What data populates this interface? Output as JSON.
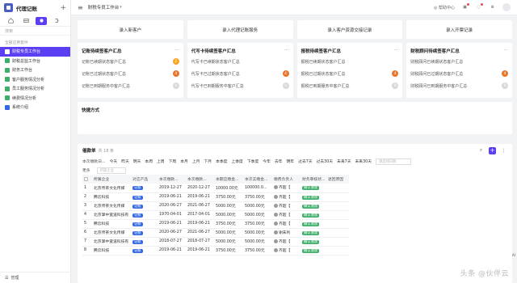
{
  "sidebar": {
    "title": "代理记账",
    "search_placeholder": "搜索",
    "group_label": "全部应用套件",
    "items": [
      {
        "label": "财税专员工作台",
        "color": "#ffffff",
        "active": true
      },
      {
        "label": "财税总监工作台",
        "color": "#3fae6a",
        "active": false
      },
      {
        "label": "财务工作台",
        "color": "#3fae6a",
        "active": false
      },
      {
        "label": "客户服务情况分析",
        "color": "#3fae6a",
        "active": false
      },
      {
        "label": "员工服务情况分析",
        "color": "#3fae6a",
        "active": false
      },
      {
        "label": "续费情况分析",
        "color": "#3fae6a",
        "active": false
      },
      {
        "label": "系统介绍",
        "color": "#3468e3",
        "active": false
      }
    ],
    "footer_label": "管理"
  },
  "topbar": {
    "title": "财税专员工作台",
    "help_label": "帮助中心"
  },
  "actions": [
    "录入新客户",
    "录入代理记账服务",
    "录入客户资源交接记录",
    "录入开票记录"
  ],
  "cards": [
    {
      "title": "记账待续签客户汇总",
      "rows": [
        {
          "label": "记账已续期状态客户汇总",
          "count": "2",
          "color": "#f5a623"
        },
        {
          "label": "记账已过期状态客户汇总",
          "count": "4",
          "color": "#e8762d"
        },
        {
          "label": "记账已到期服务中客户汇总",
          "count": "0",
          "color": "#d9d9d9"
        }
      ]
    },
    {
      "title": "代写卡待续签客户汇总",
      "rows": [
        {
          "label": "代写卡已续期状态客户汇总",
          "count": "",
          "color": ""
        },
        {
          "label": "代写卡已过期状态客户汇总",
          "count": "4",
          "color": "#e8762d"
        },
        {
          "label": "代写卡已到期服务中客户汇总",
          "count": "0",
          "color": "#d9d9d9"
        }
      ]
    },
    {
      "title": "报税待续签客户汇总",
      "rows": [
        {
          "label": "报税已续期状态客户汇总",
          "count": "",
          "color": ""
        },
        {
          "label": "报税已过期状态客户汇总",
          "count": "4",
          "color": "#e8762d"
        },
        {
          "label": "报税已到期服务中客户汇总",
          "count": "0",
          "color": "#d9d9d9"
        }
      ]
    },
    {
      "title": "财税顾问待续签客户汇总",
      "rows": [
        {
          "label": "财税顾问已续期状态客户汇总",
          "count": "",
          "color": ""
        },
        {
          "label": "财税顾问已过期状态客户汇总",
          "count": "4",
          "color": "#e8762d"
        },
        {
          "label": "财税顾问已到期服务中客户汇总",
          "count": "0",
          "color": "#d9d9d9"
        }
      ]
    }
  ],
  "quick": {
    "title": "快捷方式"
  },
  "panel": {
    "title": "催款单",
    "count": "共 18 条",
    "filter_label": "本次缴款日...",
    "chips": [
      "今天",
      "昨天",
      "明天",
      "本周",
      "上周",
      "下周",
      "本月",
      "上月",
      "下月",
      "本季度",
      "上季度",
      "下季度",
      "今年",
      "去年",
      "明年",
      "过去7天",
      "过去30天",
      "未来7天",
      "未来30天"
    ],
    "date_placeholder": "请选择日期",
    "more_label": "更多",
    "select_placeholder": "所属企业",
    "columns": [
      "",
      "所属企业",
      "对应产品",
      "本次缴款...",
      "本次缴款...",
      "本期应缴金...",
      "本次实缴金...",
      "缴费负责人",
      "财务审核状...",
      "退回原因"
    ],
    "rows": [
      {
        "n": "1",
        "company": "北京传茶文化传媒",
        "product": "记账",
        "d1": "2019-12-27",
        "d2": "2020-12-27",
        "due": "10000.00元",
        "paid": "100000.0...",
        "owner": "齐超【",
        "status": "确认收款"
      },
      {
        "n": "2",
        "company": "腾云科技",
        "product": "记账",
        "d1": "2019-06-21",
        "d2": "2019-06-21",
        "due": "3750.00元",
        "paid": "3750.00元",
        "owner": "齐超【",
        "status": "确认收款"
      },
      {
        "n": "3",
        "company": "北京传茶文化传媒",
        "product": "记账",
        "d1": "2020-06-27",
        "d2": "2021-06-27",
        "due": "5000.00元",
        "paid": "5000.00元",
        "owner": "齐超【",
        "status": "确认收款"
      },
      {
        "n": "4",
        "company": "北京掌中宽道科技有",
        "product": "记账",
        "d1": "1970-04-01",
        "d2": "2017-04-01",
        "due": "5000.00元",
        "paid": "5000.00元",
        "owner": "齐超【",
        "status": "确认收款"
      },
      {
        "n": "5",
        "company": "腾云科技",
        "product": "记账",
        "d1": "2019-06-21",
        "d2": "2019-06-21",
        "due": "3750.00元",
        "paid": "3750.00元",
        "owner": "齐超【",
        "status": "确认收款"
      },
      {
        "n": "6",
        "company": "北京传茶文化传媒",
        "product": "记账",
        "d1": "2020-06-27",
        "d2": "2021-06-27",
        "due": "5000.00元",
        "paid": "5000.00元",
        "owner": "谢朱利",
        "status": "确认收款"
      },
      {
        "n": "7",
        "company": "北京掌中宽道科技有",
        "product": "记账",
        "d1": "2018-07-27",
        "d2": "2018-07-27",
        "due": "5000.00元",
        "paid": "5000.00元",
        "owner": "齐超【",
        "status": "确认收款"
      },
      {
        "n": "8",
        "company": "腾云科技",
        "product": "记账",
        "d1": "2019-06-21",
        "d2": "2019-06-21",
        "due": "3750.00元",
        "paid": "3750.00元",
        "owner": "齐超【",
        "status": "确认收款"
      }
    ]
  },
  "watermark": "头条 @伙伴云",
  "side_float": "AI"
}
